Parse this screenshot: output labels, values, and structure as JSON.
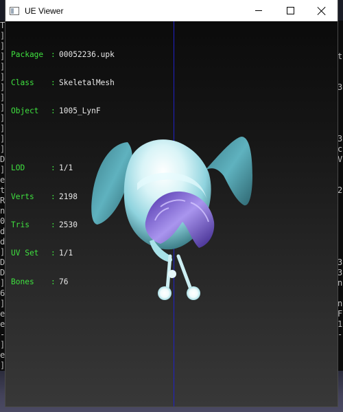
{
  "window": {
    "title": "UE Viewer"
  },
  "viewer_info": {
    "package_label": "Package",
    "package_value": "00052236.upk",
    "class_label": "Class",
    "class_value": "SkeletalMesh",
    "object_label": "Object",
    "object_value": "1005_LynF",
    "lod_label": "LOD",
    "lod_value": "1/1",
    "verts_label": "Verts",
    "verts_value": "2198",
    "tris_label": "Tris",
    "tris_value": "2530",
    "uvset_label": "UV Set",
    "uvset_value": "1/1",
    "bones_label": "Bones",
    "bones_value": "76"
  },
  "colors": {
    "info_label": "#3fe13f",
    "info_value": "#e8e8e8",
    "axis": "#2020c8",
    "model_primary": "#8fd3de",
    "model_hair": "#7b5fd0"
  },
  "console_left": [
    "T",
    "]",
    "]",
    "]",
    "]",
    "]",
    "]",
    "]",
    "]",
    "]",
    "]",
    "]",
    "]",
    "D",
    "]",
    "e",
    "t",
    "R",
    "n",
    "0",
    "d",
    "d",
    "]",
    "D",
    "D",
    "]",
    "6",
    "]",
    "e",
    "e",
    "-",
    "]",
    "e",
    "]"
  ],
  "console_right": [
    "",
    "",
    "",
    "t",
    "",
    "",
    "3",
    "",
    "",
    "",
    "",
    "3",
    "c",
    "V",
    "",
    "",
    "2",
    "",
    "",
    "",
    "",
    "",
    "",
    "3",
    "3",
    "n",
    "",
    "n",
    "F",
    "1",
    "-",
    "",
    ""
  ]
}
